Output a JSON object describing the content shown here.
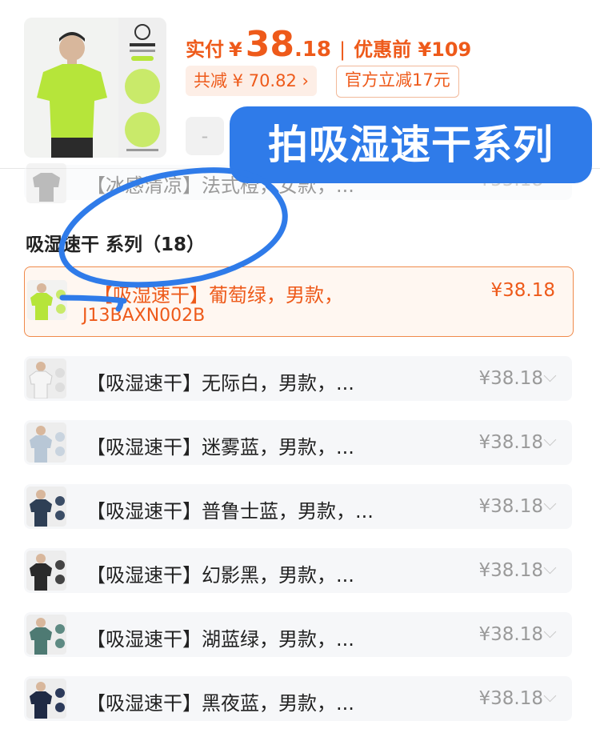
{
  "header": {
    "actual_label": "实付",
    "currency": "¥",
    "price_int": "38",
    "price_dec": ".18",
    "separator": "|",
    "original_price": "优惠前 ¥109",
    "total_discount": "共减 ¥ 70.82 ›",
    "official_discount": "官方立减17元",
    "stepper_minus": "-"
  },
  "overlay_label": "拍吸湿速干系列",
  "prev_partial": {
    "title": "【冰感清凉】法式橙，女款，...",
    "price": "¥55.18"
  },
  "section": {
    "title": "吸湿速干 系列（18）"
  },
  "selected": {
    "title_line1": "【吸湿速干】葡萄绿，男款，",
    "title_line2": "J13BAXN002B",
    "price": "¥38.18"
  },
  "items": [
    {
      "title": "【吸湿速干】无际白，男款，...",
      "price": "¥38.18",
      "shirt": "#f5f5f5"
    },
    {
      "title": "【吸湿速干】迷雾蓝，男款，...",
      "price": "¥38.18",
      "shirt": "#b8c7d6"
    },
    {
      "title": "【吸湿速干】普鲁士蓝，男款，...",
      "price": "¥38.18",
      "shirt": "#2e3f55"
    },
    {
      "title": "【吸湿速干】幻影黑，男款，...",
      "price": "¥38.18",
      "shirt": "#2a2a2a"
    },
    {
      "title": "【吸湿速干】湖蓝绿，男款，...",
      "price": "¥38.18",
      "shirt": "#4e7a73"
    },
    {
      "title": "【吸湿速干】黑夜蓝，男款，...",
      "price": "¥38.18",
      "shirt": "#1f2a44"
    }
  ],
  "colors": {
    "accent": "#ee5a1a",
    "overlay": "#2f7be9",
    "row_bg": "#f6f7f9",
    "selected_shirt": "#b6e53a"
  }
}
